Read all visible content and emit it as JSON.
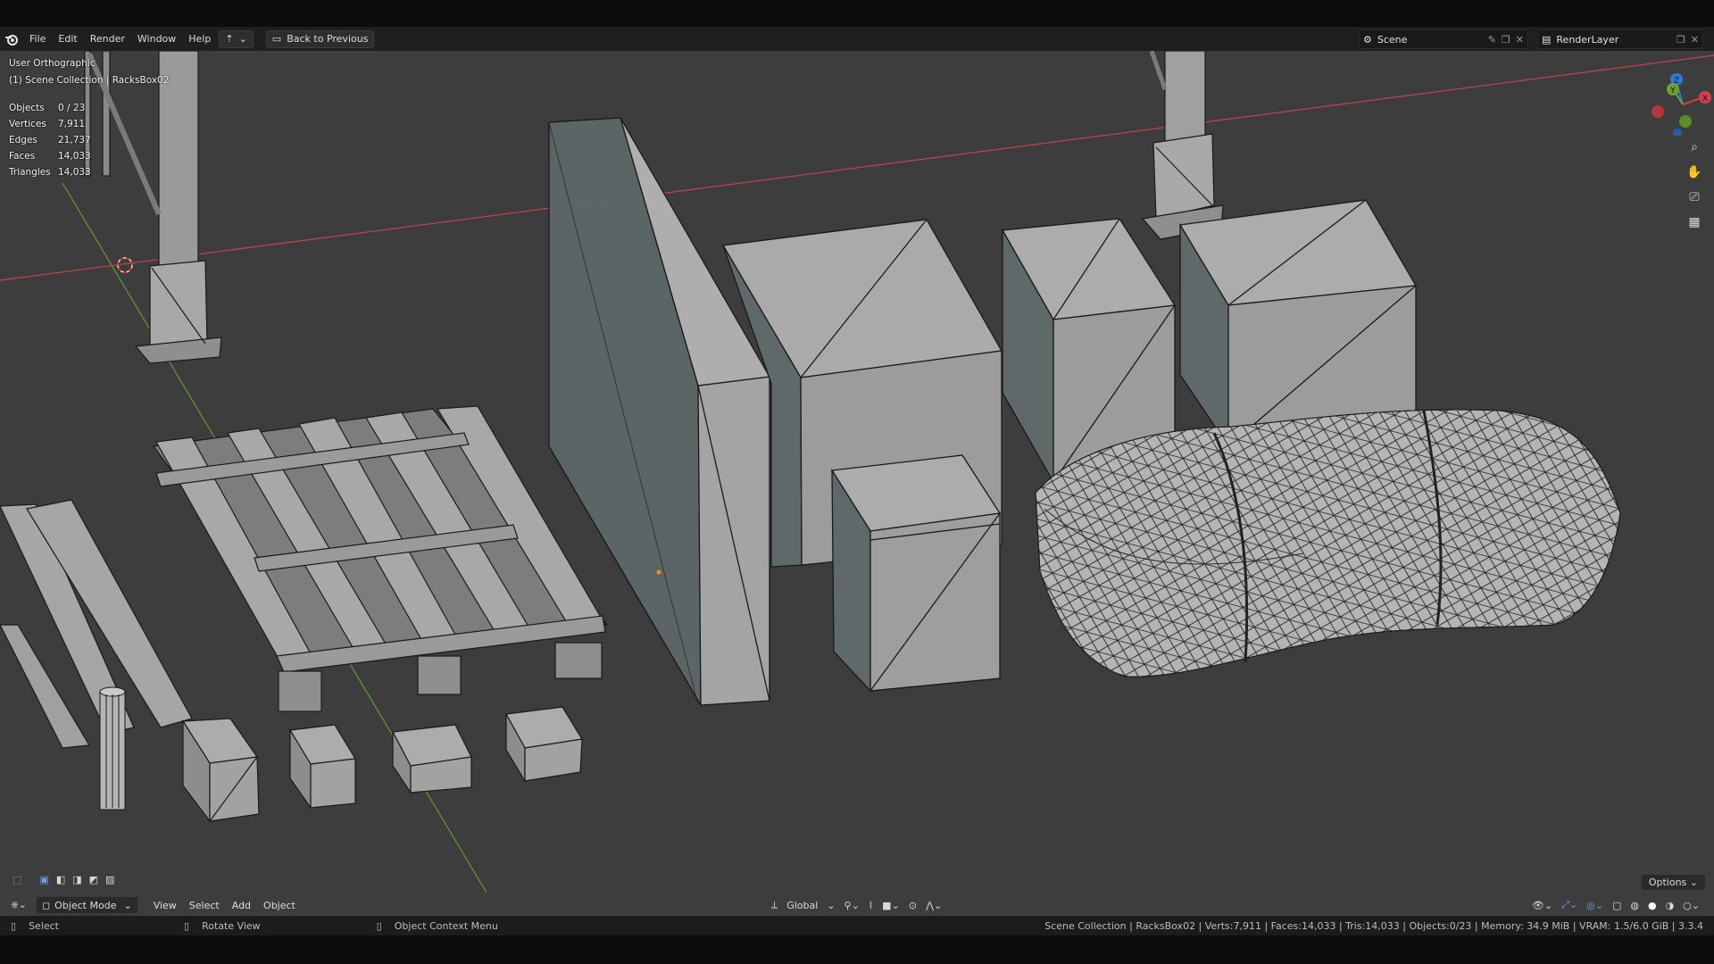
{
  "menu": [
    "File",
    "Edit",
    "Render",
    "Window",
    "Help"
  ],
  "back_button": "Back to Previous",
  "scene_field": "Scene",
  "layer_field": "RenderLayer",
  "viewport": {
    "view_name": "User Orthographic",
    "collection_info": "(1) Scene Collection | RacksBox02",
    "stats": [
      {
        "label": "Objects",
        "value": "0 / 23"
      },
      {
        "label": "Vertices",
        "value": "7,911"
      },
      {
        "label": "Edges",
        "value": "21,737"
      },
      {
        "label": "Faces",
        "value": "14,033"
      },
      {
        "label": "Triangles",
        "value": "14,033"
      }
    ],
    "options_label": "Options"
  },
  "gizmo": {
    "x": "X",
    "y": "Y",
    "z": "Z"
  },
  "header_bottom": {
    "mode": "Object Mode",
    "menus": [
      "View",
      "Select",
      "Add",
      "Object"
    ],
    "transform": "Global"
  },
  "statusbar": {
    "select": "Select",
    "rotate": "Rotate View",
    "context": "Object Context Menu",
    "info": "Scene Collection | RacksBox02 | Verts:7,911 | Faces:14,033 | Tris:14,033 | Objects:0/23 | Memory: 34.9 MiB | VRAM: 1.5/6.0 GiB | 3.3.4"
  },
  "colors": {
    "axis_x": "#c8434f",
    "axis_y": "#5f9a2f",
    "gizmo_x": "#d33f47",
    "gizmo_y": "#6ba32c",
    "gizmo_z": "#2e7bd6",
    "accent": "#4772b3"
  }
}
